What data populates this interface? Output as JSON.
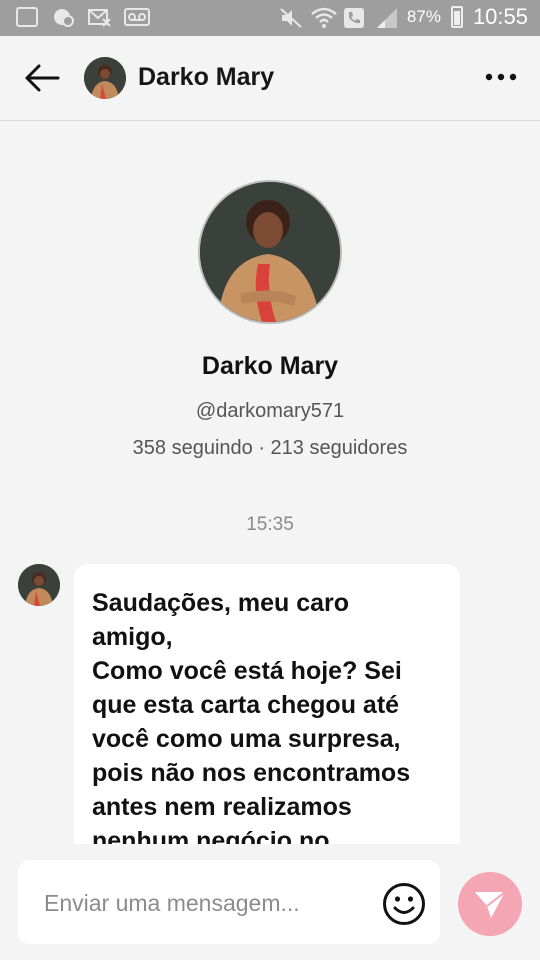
{
  "status_bar": {
    "battery_percent": "87%",
    "time": "10:55",
    "icons": [
      "gallery-icon",
      "whatsapp-icon",
      "missed-call-icon",
      "voicemail-icon",
      "mute-icon",
      "wifi-icon",
      "phone-icon",
      "signal-icon",
      "battery-icon"
    ]
  },
  "header": {
    "contact_name": "Darko Mary",
    "back_icon": "arrow-left-icon",
    "more_icon": "more-horizontal-icon"
  },
  "profile": {
    "name": "Darko Mary",
    "handle": "@darkomary571",
    "stats": "358 seguindo · 213 seguidores"
  },
  "conversation": {
    "timestamp": "15:35",
    "messages": [
      {
        "text": "Saudações, meu caro\namigo,\nComo você está hoje? Sei\nque esta carta chegou até\nvocê como uma surpresa,\npois não nos encontramos\nantes nem realizamos\nnenhum negócio no"
      }
    ]
  },
  "composer": {
    "placeholder": "Enviar uma mensagem...",
    "emoji_icon": "smiley-icon",
    "send_icon": "send-icon"
  },
  "colors": {
    "status_bar": "#9e9e9e",
    "background": "#f4f4f4",
    "send_button": "#f4a6b4",
    "bubble": "#ffffff"
  }
}
